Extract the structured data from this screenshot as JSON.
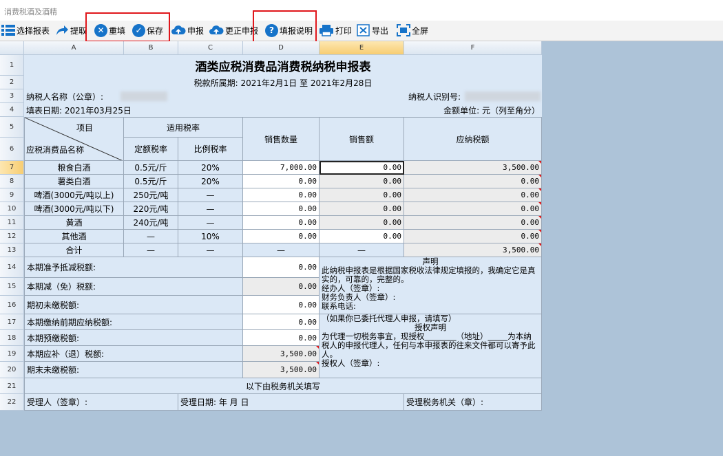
{
  "window": {
    "title": "消费税酒及酒精"
  },
  "toolbar": {
    "select_form": "选择报表",
    "fetch": "提取",
    "refill": "重填",
    "save": "保存",
    "declare": "申报",
    "correct_declare": "更正申报",
    "fill_help": "填报说明",
    "print": "打印",
    "export": "导出",
    "fullscreen": "全屏"
  },
  "columns": [
    "A",
    "B",
    "C",
    "D",
    "E",
    "F"
  ],
  "row_numbers": [
    "1",
    "2",
    "3",
    "4",
    "5",
    "6",
    "7",
    "8",
    "9",
    "10",
    "11",
    "12",
    "13",
    "14",
    "15",
    "16",
    "17",
    "18",
    "19",
    "20",
    "21",
    "22"
  ],
  "form": {
    "title": "酒类应税消费品消费税纳税申报表",
    "period": "税款所属期:  2021年2月1日 至 2021年2月28日",
    "taxpayer_name_label": "纳税人名称（公章）:",
    "taxpayer_id_label": "纳税人识别号:",
    "fill_date": "填表日期: 2021年03月25日",
    "unit": "金额单位: 元（列至角分）",
    "hdr_item": "项目",
    "hdr_goods": "应税消费品名称",
    "hdr_rate": "适用税率",
    "hdr_fixed": "定额税率",
    "hdr_ratio": "比例税率",
    "hdr_qty": "销售数量",
    "hdr_sales": "销售额",
    "hdr_tax": "应纳税额",
    "rows": [
      {
        "name": "粮食白酒",
        "fixed": "0.5元/斤",
        "ratio": "20%",
        "qty": "7,000.00",
        "sales": "0.00",
        "tax": "3,500.00"
      },
      {
        "name": "薯类白酒",
        "fixed": "0.5元/斤",
        "ratio": "20%",
        "qty": "0.00",
        "sales": "0.00",
        "tax": "0.00"
      },
      {
        "name": "啤酒(3000元/吨以上)",
        "fixed": "250元/吨",
        "ratio": "—",
        "qty": "0.00",
        "sales": "0.00",
        "tax": "0.00"
      },
      {
        "name": "啤酒(3000元/吨以下)",
        "fixed": "220元/吨",
        "ratio": "—",
        "qty": "0.00",
        "sales": "0.00",
        "tax": "0.00"
      },
      {
        "name": "黄酒",
        "fixed": "240元/吨",
        "ratio": "—",
        "qty": "0.00",
        "sales": "0.00",
        "tax": "0.00"
      },
      {
        "name": "其他酒",
        "fixed": "—",
        "ratio": "10%",
        "qty": "0.00",
        "sales": "0.00",
        "tax": "0.00"
      },
      {
        "name": "合计",
        "fixed": "—",
        "ratio": "—",
        "qty": "—",
        "sales": "—",
        "tax": "3,500.00"
      }
    ],
    "lower": [
      {
        "label": "本期准予抵减税额:",
        "value": "0.00"
      },
      {
        "label": "本期减（免）税额:",
        "value": "0.00"
      },
      {
        "label": "期初未缴税额:",
        "value": "0.00"
      },
      {
        "label": "本期缴纳前期应纳税额:",
        "value": "0.00"
      },
      {
        "label": "本期预缴税额:",
        "value": "0.00"
      },
      {
        "label": "本期应补（退）税额:",
        "value": "3,500.00"
      },
      {
        "label": "期末未缴税额:",
        "value": "3,500.00"
      }
    ],
    "declaration_title": "声明",
    "declaration_text": "此纳税申报表是根据国家税收法律规定填报的，我确定它是真实的，可靠的，完整的。",
    "handler": "经办人（签章）:",
    "finance": "财务负责人（签章）:",
    "phone": "联系电话:",
    "agent_note": "（如果你已委托代理人申报，请填写）",
    "auth_title": "授权声明",
    "auth_text": "为代理一切税务事宜，现授权________（地址）_____为本纳税人的申报代理人，任何与本申报表的往来文件都可以寄予此人。",
    "authorizer": "授权人（签章）:",
    "tax_office_fill": "以下由税务机关填写",
    "receiver": "受理人（签章）:",
    "receive_date": "受理日期:      年    月    日",
    "receive_office": "受理税务机关（章）:"
  }
}
